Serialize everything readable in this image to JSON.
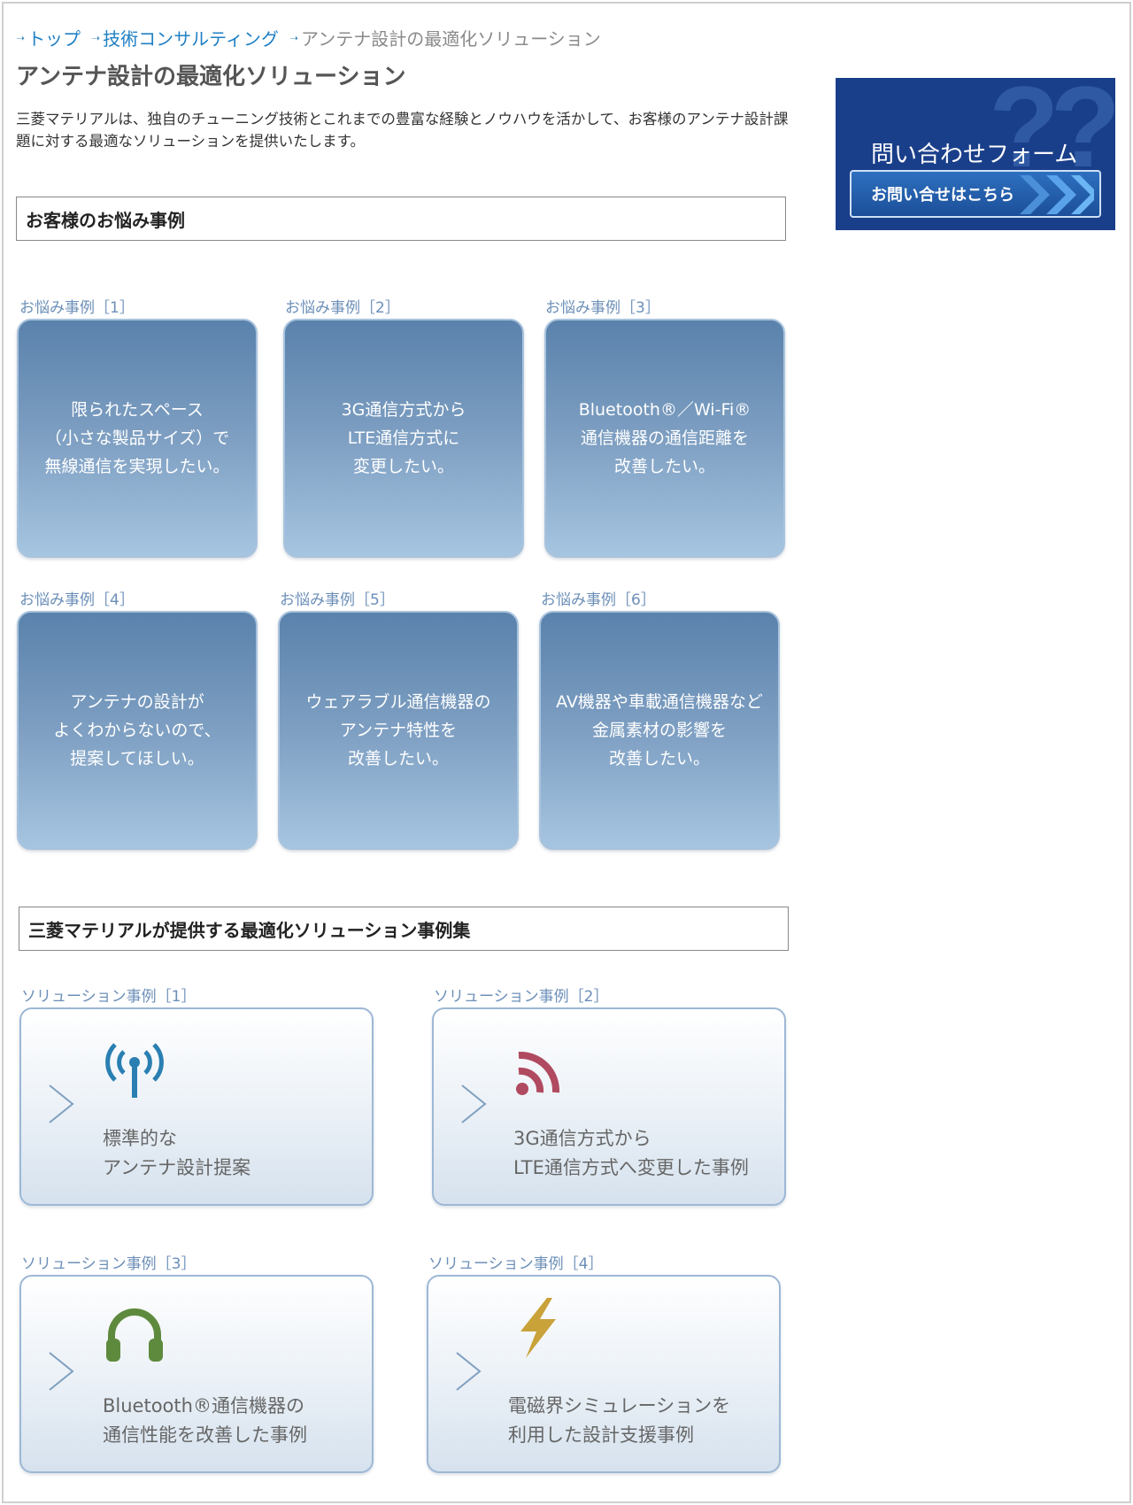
{
  "breadcrumb": [
    {
      "label": "トップ",
      "link": true
    },
    {
      "label": "技術コンサルティング",
      "link": true
    },
    {
      "label": "アンテナ設計の最適化ソリューション",
      "link": false
    }
  ],
  "page_title": "アンテナ設計の最適化ソリューション",
  "intro": "三菱マテリアルは、独自のチューニング技術とこれまでの豊富な経験とノウハウを活かして、お客様のアンテナ設計課題に対する最適なソリューションを提供いたします。",
  "worries": {
    "heading": "お客様のお悩み事例",
    "items": [
      {
        "label": "お悩み事例［1］",
        "text": "限られたスペース\n（小さな製品サイズ）で\n無線通信を実現したい。"
      },
      {
        "label": "お悩み事例［2］",
        "text": "3G通信方式から\nLTE通信方式に\n変更したい。"
      },
      {
        "label": "お悩み事例［3］",
        "text": "Bluetooth®／Wi-Fi®\n通信機器の通信距離を\n改善したい。"
      },
      {
        "label": "お悩み事例［4］",
        "text": "アンテナの設計が\nよくわからないので、\n提案してほしい。"
      },
      {
        "label": "お悩み事例［5］",
        "text": "ウェアラブル通信機器の\nアンテナ特性を\n改善したい。"
      },
      {
        "label": "お悩み事例［6］",
        "text": "AV機器や車載通信機器など\n金属素材の影響を\n改善したい。"
      }
    ]
  },
  "solutions": {
    "heading": "三菱マテリアルが提供する最適化ソリューション事例集",
    "items": [
      {
        "label": "ソリューション事例［1］",
        "text": "標準的な\nアンテナ設計提案",
        "icon": "antenna-icon",
        "color": "#2a7fb2"
      },
      {
        "label": "ソリューション事例［2］",
        "text": "3G通信方式から\nLTE通信方式へ変更した事例",
        "icon": "signal-icon",
        "color": "#b04a60"
      },
      {
        "label": "ソリューション事例［3］",
        "text": "Bluetooth®通信機器の\n通信性能を改善した事例",
        "icon": "headphones-icon",
        "color": "#5e8a3e"
      },
      {
        "label": "ソリューション事例［4］",
        "text": "電磁界シミュレーションを\n利用した設計支援事例",
        "icon": "lightning-icon",
        "color": "#c9a23a"
      }
    ]
  },
  "contact": {
    "title": "問い合わせフォーム",
    "button": "お問い合せはこちら",
    "bg_color": "#1a3f8a"
  }
}
